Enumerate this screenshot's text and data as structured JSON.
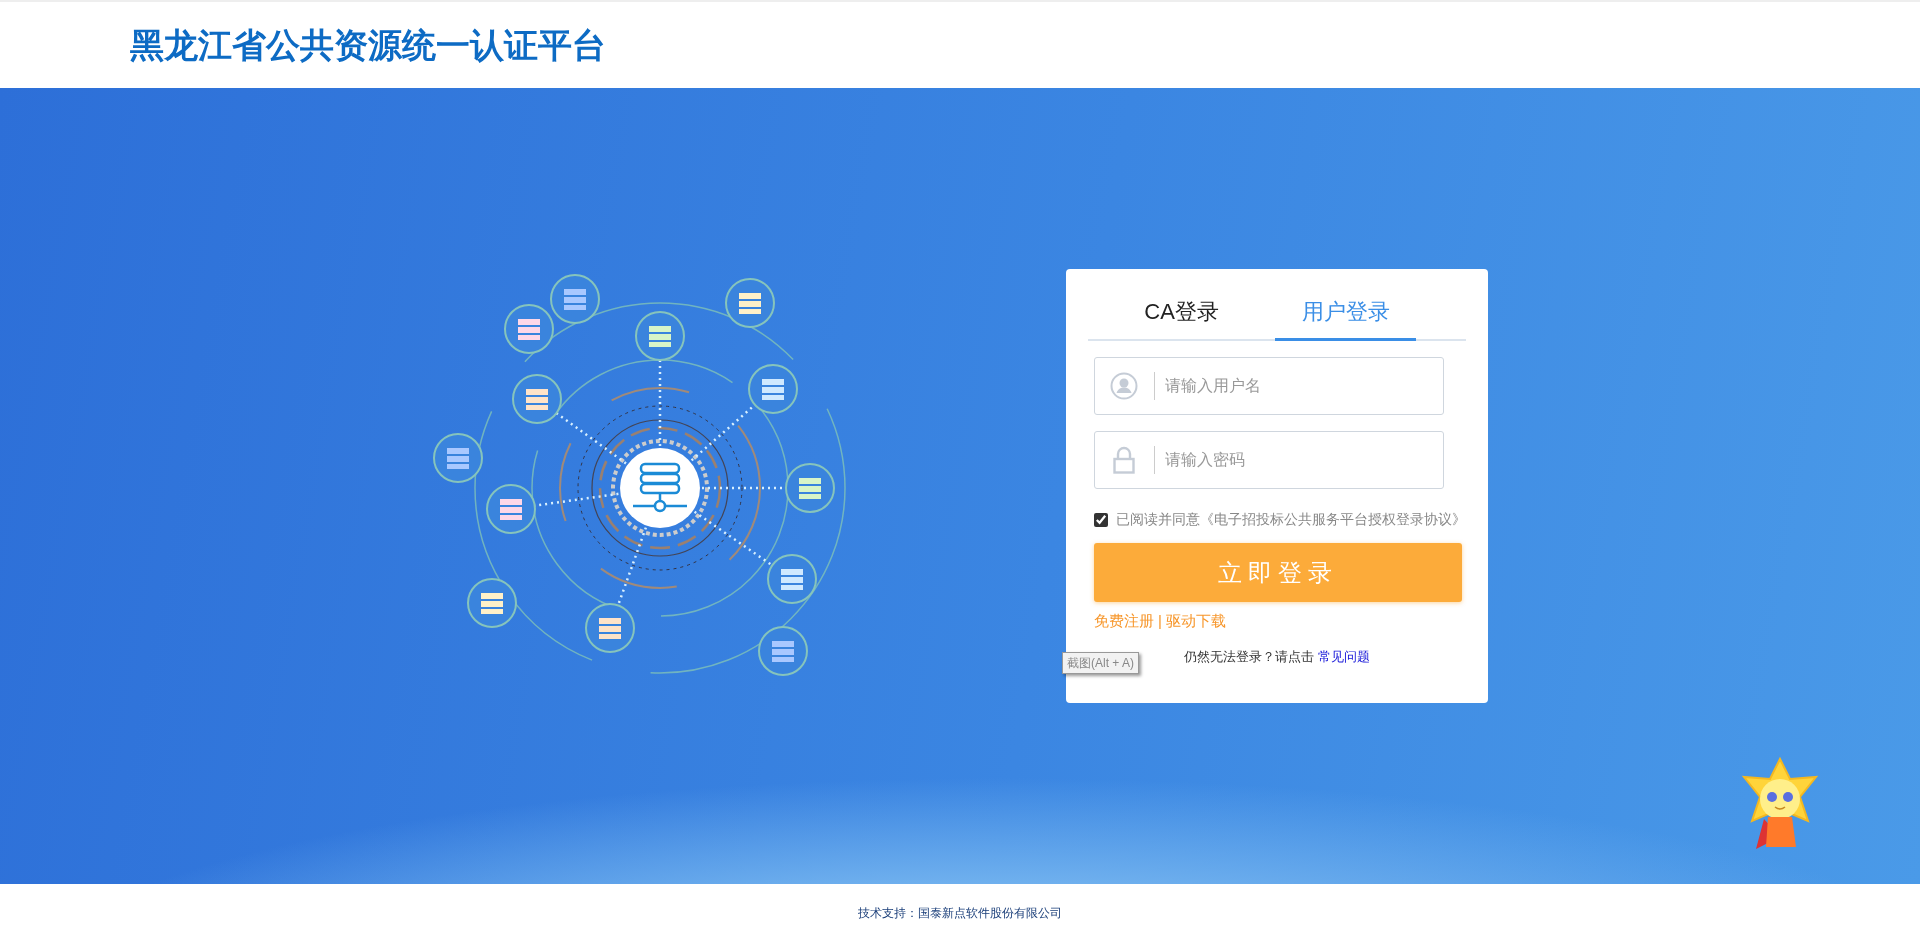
{
  "header": {
    "title": "黑龙江省公共资源统一认证平台"
  },
  "login": {
    "tabs": [
      {
        "label": "CA登录",
        "selected": false
      },
      {
        "label": "用户登录",
        "selected": true
      }
    ],
    "fields": [
      {
        "kind": "user",
        "placeholder": "请输入用户名"
      },
      {
        "kind": "password",
        "placeholder": "请输入密码"
      }
    ],
    "agreement": {
      "checked": true,
      "text": "已阅读并同意《电子招投标公共服务平台授权登录协议》"
    },
    "submit": "立即登录",
    "links": [
      {
        "label": "免费注册"
      },
      {
        "label": "驱动下载"
      }
    ],
    "link_separator": "|",
    "help": {
      "text": "仍然无法登录？请点击",
      "link": "常见问题"
    }
  },
  "tooltip": "截图(Alt + A)",
  "footer": {
    "text": "技术支持：国泰新点软件股份有限公司"
  }
}
